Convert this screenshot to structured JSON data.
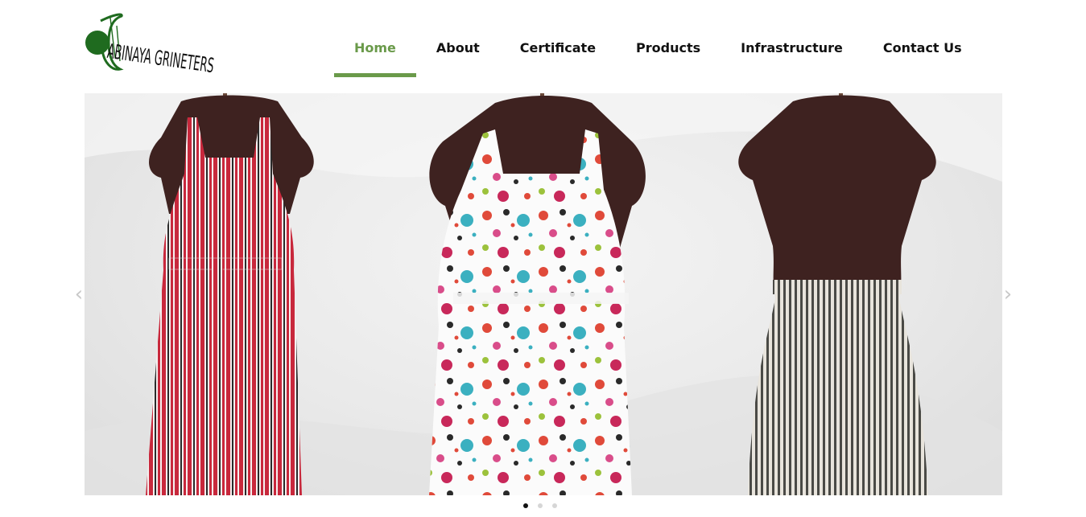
{
  "brand": {
    "name": "ABINAYA GRINETERS",
    "logo_color": "#1f6b1f"
  },
  "nav": {
    "accent": "#6a9a4a",
    "items": [
      {
        "label": "Home",
        "active": true
      },
      {
        "label": "About",
        "active": false
      },
      {
        "label": "Certificate",
        "active": false
      },
      {
        "label": "Products",
        "active": false
      },
      {
        "label": "Infrastructure",
        "active": false
      },
      {
        "label": "Contact Us",
        "active": false
      }
    ]
  },
  "slider": {
    "image_alt": "Three aprons on mannequins: red striped, polka dot, and grey striped waist apron",
    "prev_icon": "chevron-left-icon",
    "next_icon": "chevron-right-icon",
    "slides_count": 3,
    "active_slide": 1
  }
}
